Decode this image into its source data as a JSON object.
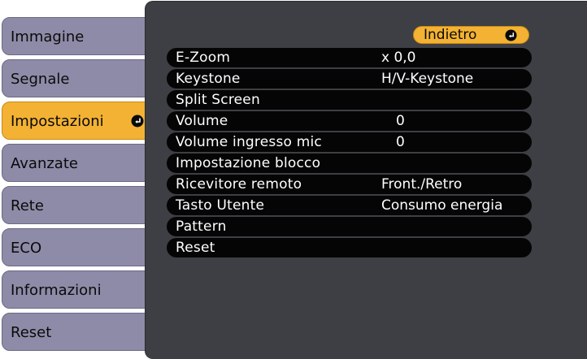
{
  "sidebar": {
    "items": [
      {
        "label": "Immagine"
      },
      {
        "label": "Segnale"
      },
      {
        "label": "Impostazioni"
      },
      {
        "label": "Avanzate"
      },
      {
        "label": "Rete"
      },
      {
        "label": "ECO"
      },
      {
        "label": "Informazioni"
      },
      {
        "label": "Reset"
      }
    ],
    "active_index": 2
  },
  "back_button": {
    "label": "Indietro"
  },
  "menu": {
    "rows": [
      {
        "label": "E-Zoom",
        "value": "x  0,0"
      },
      {
        "label": "Keystone",
        "value": "H/V-Keystone"
      },
      {
        "label": "Split Screen",
        "value": ""
      },
      {
        "label": "Volume",
        "value": "0"
      },
      {
        "label": "Volume ingresso mic",
        "value": "0"
      },
      {
        "label": "Impostazione blocco",
        "value": ""
      },
      {
        "label": "Ricevitore remoto",
        "value": "Front./Retro"
      },
      {
        "label": "Tasto Utente",
        "value": "Consumo energia"
      },
      {
        "label": "Pattern",
        "value": ""
      },
      {
        "label": "Reset",
        "value": ""
      }
    ]
  },
  "colors": {
    "tab_inactive": "#8e8ba8",
    "tab_active": "#f3b233",
    "panel_bg": "#3e3f44",
    "row_bg": "#050505",
    "row_text": "#ffffff"
  },
  "icons": {
    "enter": "enter-return-icon"
  }
}
